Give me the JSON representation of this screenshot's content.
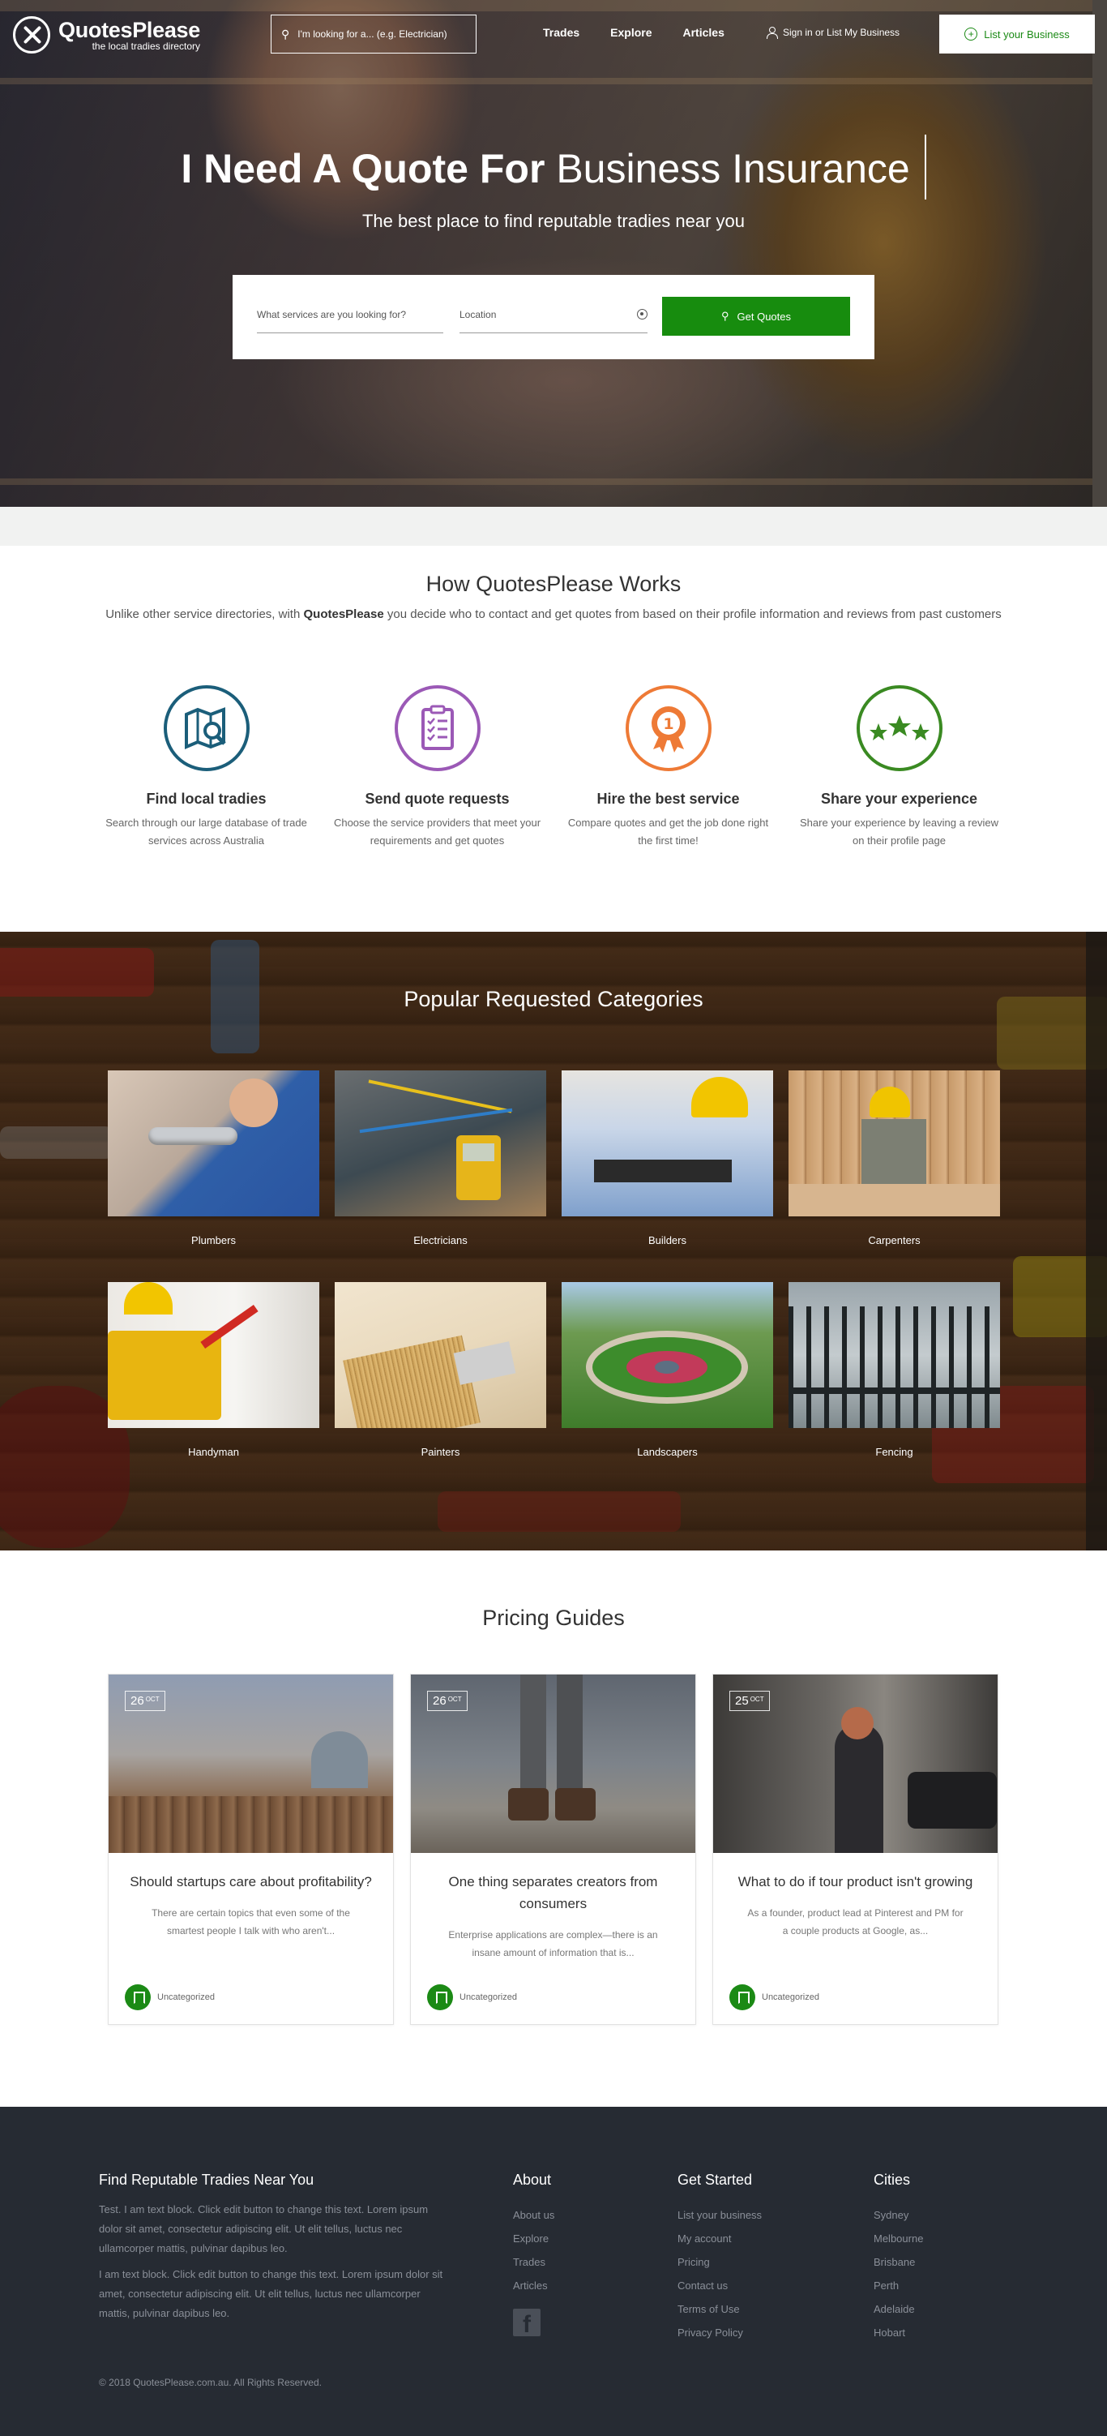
{
  "header": {
    "logo_name": "QuotesPlease",
    "logo_tagline": "the local tradies directory",
    "search_text": "I'm looking for a... (e.g. Electrician)",
    "nav": [
      "Trades",
      "Explore",
      "Articles"
    ],
    "signin": "Sign in or List My Business",
    "list_business": "List your Business"
  },
  "hero": {
    "title_bold": "I Need A Quote For",
    "title_rest": "Business Insurance",
    "subtitle": "The best place to find reputable tradies near you",
    "service_placeholder": "What services are you looking for?",
    "location_placeholder": "Location",
    "button": "Get Quotes"
  },
  "how": {
    "title": "How QuotesPlease Works",
    "desc_pre": "Unlike other service directories, with ",
    "desc_brand": "QuotesPlease",
    "desc_post": " you decide who to contact and get quotes from based on their profile information and reviews from past customers",
    "steps": [
      {
        "title": "Find local tradies",
        "text": "Search through our large database of trade services across Australia",
        "icon": "map-search-icon",
        "color": "#1b5e7a"
      },
      {
        "title": "Send quote requests",
        "text": "Choose the service providers that meet your requirements and get quotes",
        "icon": "clipboard-icon",
        "color": "#9b59b6"
      },
      {
        "title": "Hire the best service",
        "text": "Compare quotes and get the job done right the first time!",
        "icon": "award-icon",
        "color": "#ee7a36"
      },
      {
        "title": "Share your experience",
        "text": "Share your experience by leaving a review on their profile page",
        "icon": "stars-icon",
        "color": "#3a8a22"
      }
    ]
  },
  "categories": {
    "title": "Popular Requested Categories",
    "items": [
      "Plumbers",
      "Electricians",
      "Builders",
      "Carpenters",
      "Handyman",
      "Painters",
      "Landscapers",
      "Fencing"
    ]
  },
  "pricing": {
    "title": "Pricing Guides",
    "posts": [
      {
        "day": "26",
        "month": "OCT",
        "title": "Should startups care about profitability?",
        "excerpt": "There are certain topics that even some of the smartest people I talk with who aren't...",
        "category": "Uncategorized"
      },
      {
        "day": "26",
        "month": "OCT",
        "title": "One thing separates creators from consumers",
        "excerpt": "Enterprise applications are complex—there is an insane amount of information that is...",
        "category": "Uncategorized"
      },
      {
        "day": "25",
        "month": "OCT",
        "title": "What to do if tour product isn't growing",
        "excerpt": "As a founder, product lead at Pinterest and PM for a couple products at Google, as...",
        "category": "Uncategorized"
      }
    ]
  },
  "footer": {
    "col1_title": "Find Reputable Tradies Near You",
    "col1_p1": "Test. I am text block. Click edit button to change this text. Lorem ipsum dolor sit amet, consectetur adipiscing elit. Ut elit tellus, luctus nec ullamcorper mattis, pulvinar dapibus leo.",
    "col1_p2": "I am text block. Click edit button to change this text. Lorem ipsum dolor sit amet, consectetur adipiscing elit. Ut elit tellus, luctus nec ullamcorper mattis, pulvinar dapibus leo.",
    "about_title": "About",
    "about": [
      "About us",
      "Explore",
      "Trades",
      "Articles"
    ],
    "started_title": "Get Started",
    "started": [
      "List your business",
      "My account",
      "Pricing",
      "Contact us",
      "Terms of Use",
      "Privacy Policy"
    ],
    "cities_title": "Cities",
    "cities": [
      "Sydney",
      "Melbourne",
      "Brisbane",
      "Perth",
      "Adelaide",
      "Hobart"
    ],
    "copyright": "© 2018 QuotesPlease.com.au. All Rights Reserved."
  },
  "colors": {
    "accent_green": "#178c0e",
    "footer_bg": "#262b33"
  }
}
